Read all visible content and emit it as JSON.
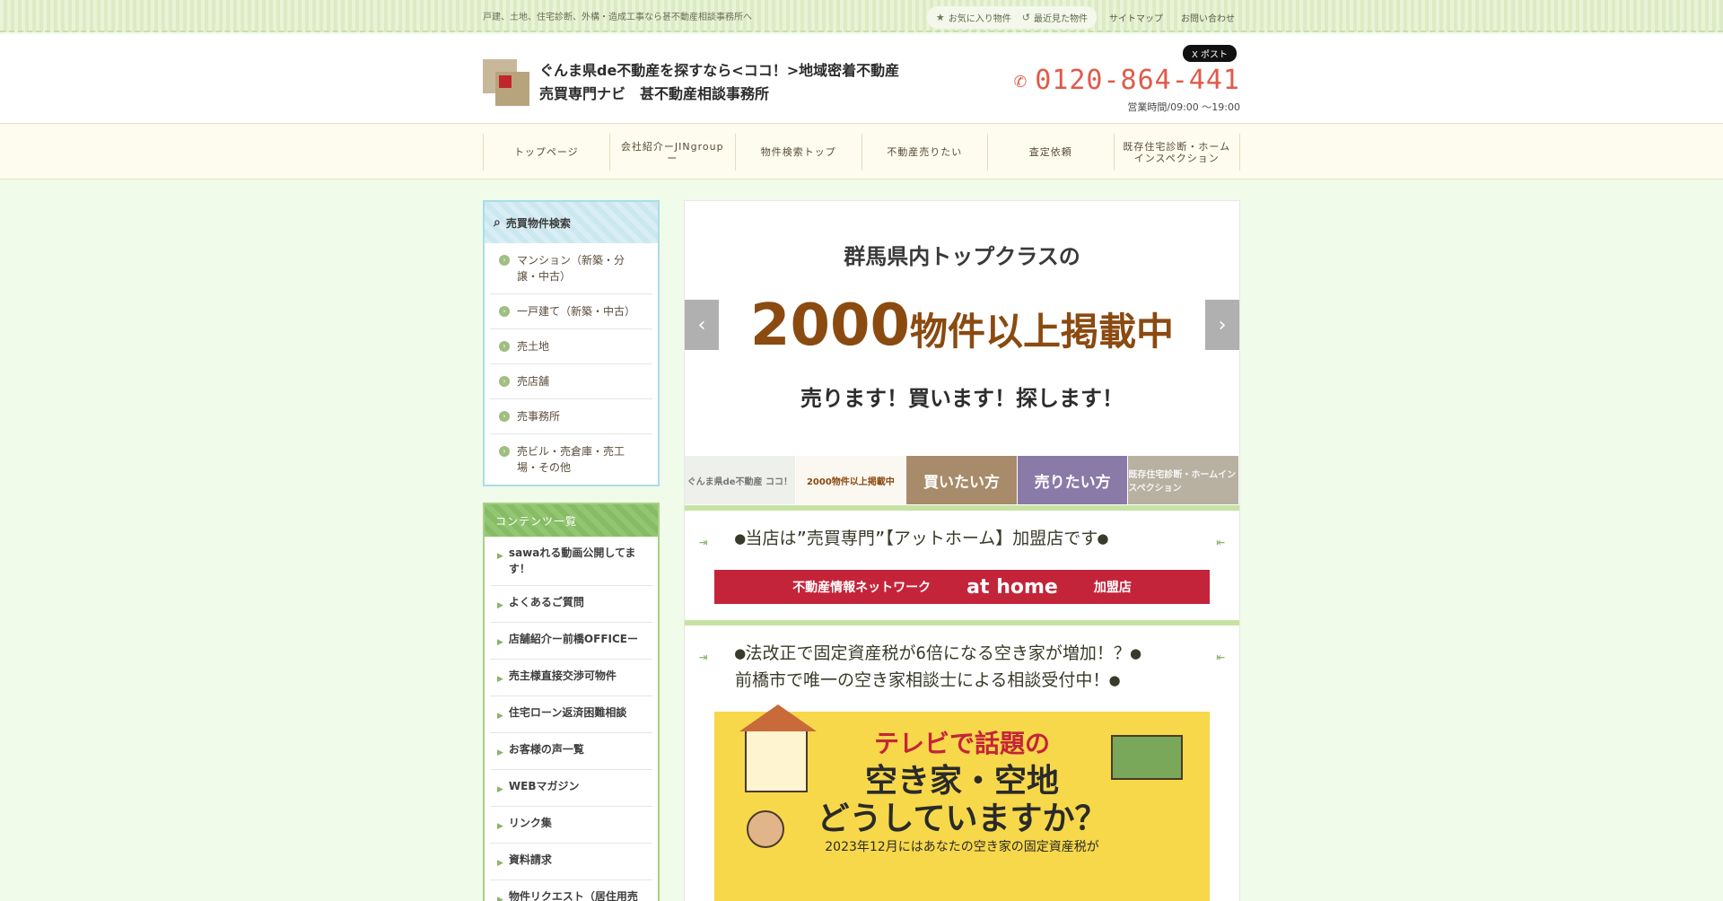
{
  "topbar": {
    "tagline": "戸建、土地、住宅診断、外構・造成工事なら甚不動産相談事務所へ",
    "favorites_label": "お気に入り物件",
    "recent_label": "最近見た物件",
    "sitemap_label": "サイトマップ",
    "contact_label": "お問い合わせ"
  },
  "header": {
    "title_line1": "ぐんま県de不動産を探すなら<ココ！>地域密着不動産",
    "title_line2": "売買専門ナビ　甚不動産相談事務所",
    "xpost_label": "X ポスト",
    "phone": "0120-864-441",
    "hours": "営業時間/09:00 〜19:00"
  },
  "gnav": {
    "items": [
      {
        "label": "トップページ"
      },
      {
        "label": "会社紹介ーJINgroupー"
      },
      {
        "label": "物件検索トップ"
      },
      {
        "label": "不動産売りたい"
      },
      {
        "label": "査定依頼"
      },
      {
        "label": "既存住宅診断・ホームインスペクション"
      }
    ]
  },
  "sidebar": {
    "search_title": "売買物件検索",
    "search_items": [
      {
        "label": "マンション（新築・分譲・中古）"
      },
      {
        "label": "一戸建て（新築・中古）"
      },
      {
        "label": "売土地"
      },
      {
        "label": "売店舗"
      },
      {
        "label": "売事務所"
      },
      {
        "label": "売ビル・売倉庫・売工場・その他"
      }
    ],
    "contents_title": "コンテンツ一覧",
    "contents_items": [
      {
        "label": "sawaれる動画公開してます！"
      },
      {
        "label": "よくあるご質問"
      },
      {
        "label": "店舗紹介ー前橋OFFICEー"
      },
      {
        "label": "売主様直接交渉可物件"
      },
      {
        "label": "住宅ローン返済困難相談"
      },
      {
        "label": "お客様の声一覧"
      },
      {
        "label": "WEBマガジン"
      },
      {
        "label": "リンク集"
      },
      {
        "label": "資料請求"
      },
      {
        "label": "物件リクエスト（居住用売買）"
      }
    ]
  },
  "slider": {
    "line1": "群馬県内トップクラスの",
    "line2_number": "2000",
    "line2_rest": "物件以上掲載中",
    "line3": "売ります！買います！探します！",
    "prev_icon": "chevron-left-icon",
    "next_icon": "chevron-right-icon",
    "thumbs": [
      {
        "label": "ぐんま県de不動産 ココ！"
      },
      {
        "label": "2000物件以上掲載中"
      },
      {
        "label": "買いたい方"
      },
      {
        "label": "売りたい方"
      },
      {
        "label": "既存住宅診断・ホームインスペクション"
      }
    ]
  },
  "sections": {
    "athome_title": "●当店は”売買専門”【アットホーム】加盟店です●",
    "athome_banner_left": "不動産情報ネットワーク",
    "athome_banner_logo": "at home",
    "athome_banner_right": "加盟店",
    "akiya_title_line1": "●法改正で固定資産税が6倍になる空き家が増加！？●",
    "akiya_title_line2": "前橋市で唯一の空き家相談士による相談受付中！●",
    "akiya_banner_l1": "テレビで話題の",
    "akiya_banner_l2": "空き家・空地",
    "akiya_banner_l3": "どうしていますか？",
    "akiya_banner_l4": "2023年12月にはあなたの空き家の固定資産税が"
  },
  "colors": {
    "accent_green": "#8ab56a",
    "phone_red": "#e05a4a",
    "athome_red": "#c4243a",
    "banner_yellow": "#f7d84a"
  }
}
